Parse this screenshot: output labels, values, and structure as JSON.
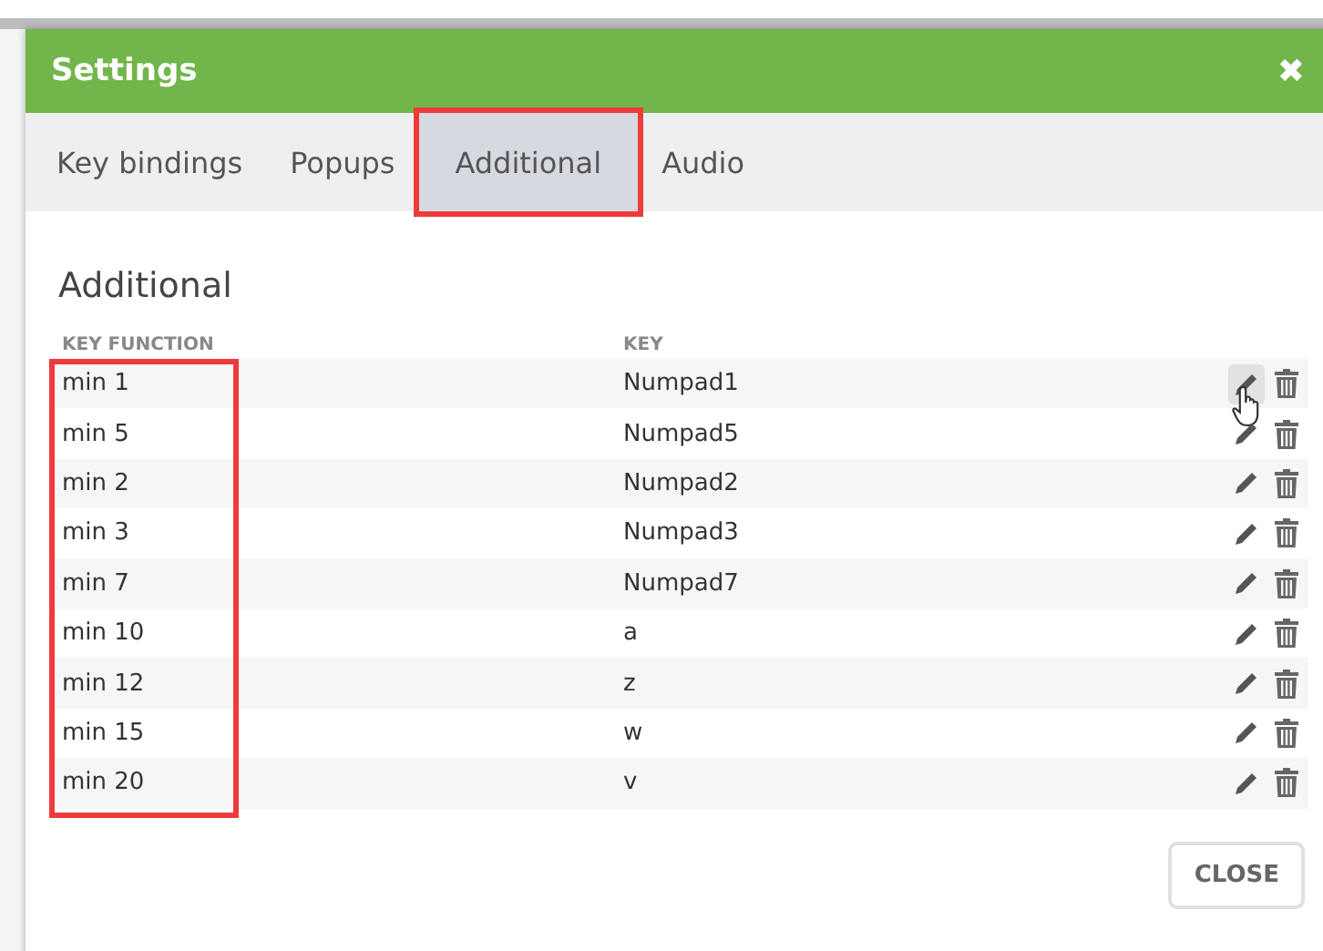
{
  "window": {
    "title": "Settings",
    "close": "✖"
  },
  "tabs": [
    {
      "label": "Key bindings",
      "selected": false,
      "highlighted": false
    },
    {
      "label": "Popups",
      "selected": false,
      "highlighted": false
    },
    {
      "label": "Additional",
      "selected": true,
      "highlighted": true
    },
    {
      "label": "Audio",
      "selected": false,
      "highlighted": false
    }
  ],
  "section_title": "Additional",
  "table": {
    "columns": [
      {
        "label": "KEY FUNCTION",
        "highlighted": true
      },
      {
        "label": "KEY"
      }
    ],
    "rows": [
      {
        "function": "min 1",
        "key": "Numpad1",
        "hovered": true
      },
      {
        "function": "min 5",
        "key": "Numpad5",
        "hovered": false
      },
      {
        "function": "min 2",
        "key": "Numpad2",
        "hovered": false
      },
      {
        "function": "min 3",
        "key": "Numpad3",
        "hovered": false
      },
      {
        "function": "min 7",
        "key": "Numpad7",
        "hovered": false
      },
      {
        "function": "min 10",
        "key": "a",
        "hovered": false
      },
      {
        "function": "min 12",
        "key": "z",
        "hovered": false
      },
      {
        "function": "min 15",
        "key": "w",
        "hovered": false
      },
      {
        "function": "min 20",
        "key": "v",
        "hovered": false
      }
    ]
  },
  "buttons": [
    {
      "label": "CLOSE"
    }
  ]
}
